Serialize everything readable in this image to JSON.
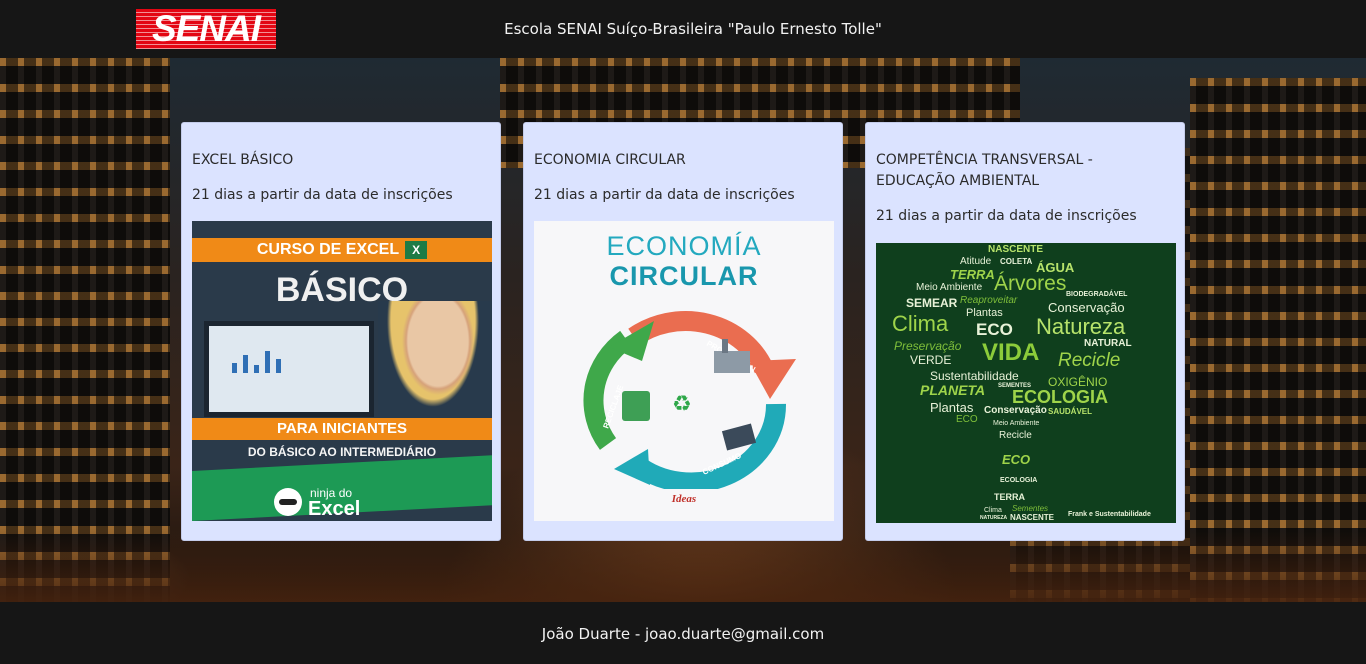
{
  "header": {
    "logo_text": "SENAI",
    "school_name": "Escola SENAI Suíço-Brasileira \"Paulo Ernesto Tolle\""
  },
  "courses": [
    {
      "title": "EXCEL BÁSICO",
      "duration": "21 dias a partir da data de inscrições",
      "thumb": {
        "band_top": "CURSO DE EXCEL",
        "xl_badge": "X",
        "headline": "BÁSICO",
        "band_mid": "PARA INICIANTES",
        "sub": "DO BÁSICO AO INTERMEDIÁRIO",
        "brand_top": "ninja do",
        "brand_bottom": "Excel"
      }
    },
    {
      "title": "ECONOMIA CIRCULAR",
      "duration": "21 dias a partir da data de inscrições",
      "thumb": {
        "line1": "ECONOMÍA",
        "line2": "CIRCULAR",
        "arc_produccion": "PRODUCCIÓN",
        "arc_consumo": "CONSUMO",
        "arc_reciclaje": "RECICLAJE",
        "credit": "Ideas"
      }
    },
    {
      "title": "COMPETÊNCIA TRANSVERSAL - EDUCAÇÃO AMBIENTAL",
      "duration": "21 dias a partir da data de inscrições",
      "thumb": {
        "words": [
          "NASCENTE",
          "Atitude",
          "COLETA",
          "TERRA",
          "ÁGUA",
          "Meio Ambiente",
          "Árvores",
          "SEMEAR",
          "Reaproveitar",
          "BIODEGRADÁVEL",
          "Plantas",
          "Conservação",
          "Clima",
          "ECO",
          "Natureza",
          "Preservação",
          "VIDA",
          "NATURAL",
          "VERDE",
          "Recicle",
          "Sustentabilidade",
          "OXIGÊNIO",
          "PLANETA",
          "SEMENTES",
          "ECOLOGIA",
          "Plantas",
          "Conservação",
          "SAUDÁVEL",
          "ECO",
          "Meio Ambiente",
          "Recicle",
          "ECO",
          "ECOLOGIA",
          "TERRA",
          "Clima",
          "Sementes",
          "NATUREZA",
          "NASCENTE"
        ],
        "credit": "Frank e Sustentabilidade"
      }
    }
  ],
  "footer": {
    "credit": "João Duarte - joao.duarte@gmail.com"
  }
}
